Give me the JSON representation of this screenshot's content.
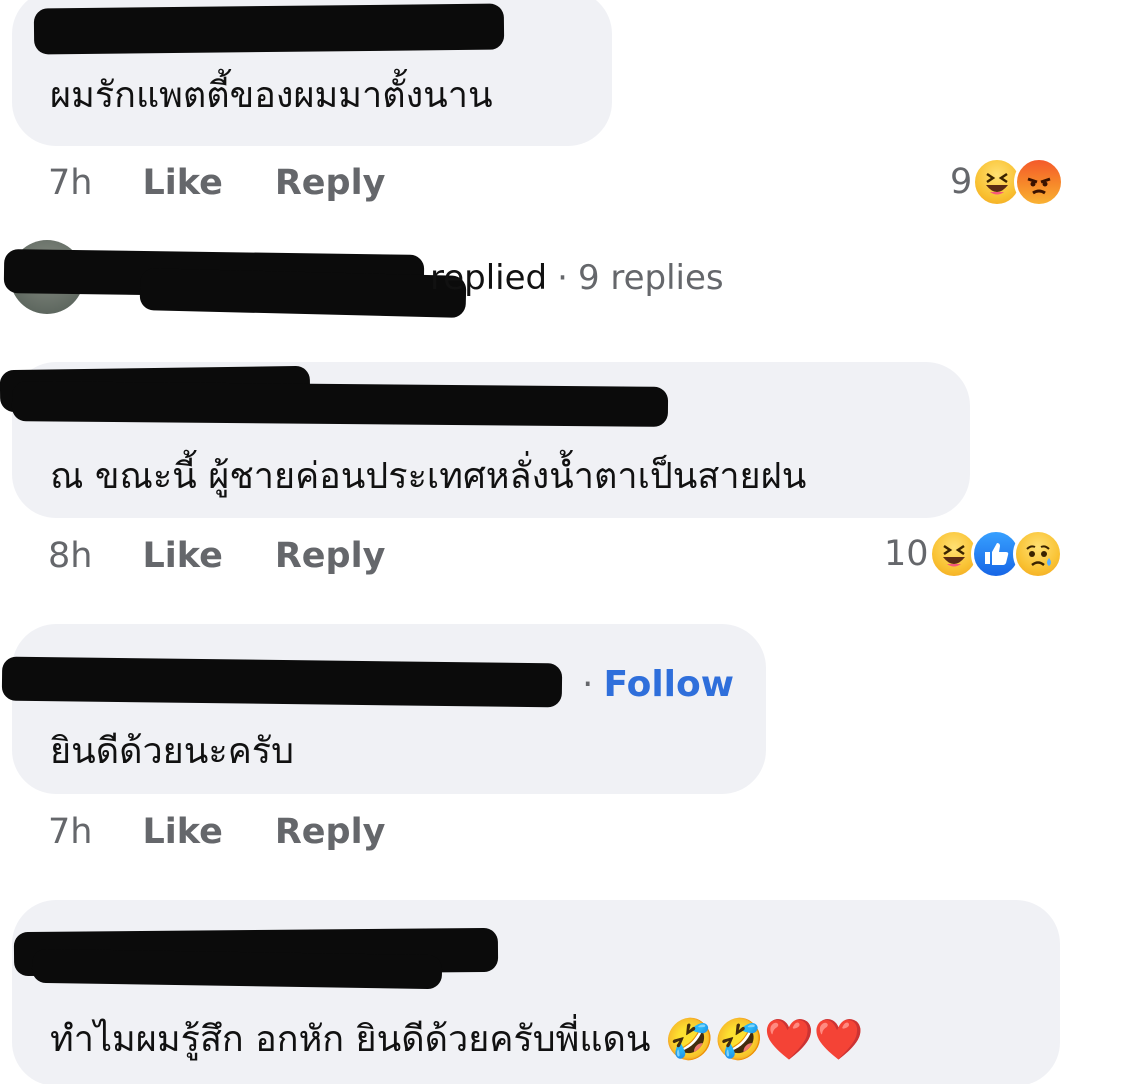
{
  "comments": [
    {
      "text": "ผมรักแพตตี้ของผมมาตั้งนาน",
      "time": "7h",
      "like": "Like",
      "reply": "Reply",
      "reaction_count": "9",
      "reactions": [
        "haha",
        "angry"
      ]
    },
    {
      "text": "ณ ขณะนี้ ผู้ชายค่อนประเทศหลั่งน้ำตาเป็นสายฝน",
      "time": "8h",
      "like": "Like",
      "reply": "Reply",
      "reaction_count": "10",
      "reactions": [
        "haha",
        "like",
        "sad"
      ]
    },
    {
      "text": "ยินดีด้วยนะครับ",
      "follow": "Follow",
      "time": "7h",
      "like": "Like",
      "reply": "Reply"
    },
    {
      "text": "ทำไมผมรู้สึก อกหัก ยินดีด้วยครับพี่แดน",
      "emojis": "🤣🤣❤️❤️"
    }
  ],
  "replies_summary": {
    "who_suffix": "replied",
    "separator": "·",
    "count": "9 replies"
  },
  "colors": {
    "bubble": "#f0f1f5",
    "meta_text": "#65676b",
    "follow": "#2f6fdb"
  }
}
